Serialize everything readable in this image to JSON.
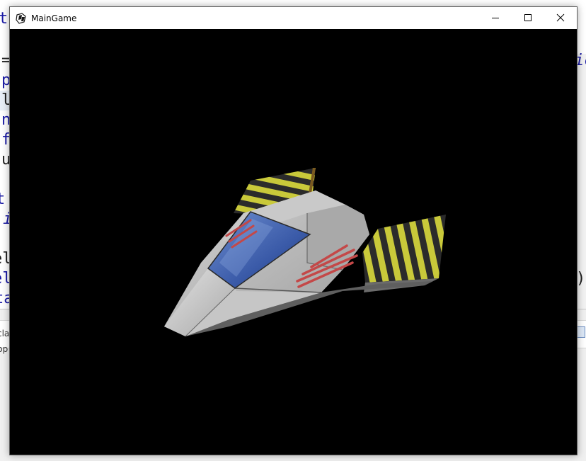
{
  "window": {
    "title": "MainGame",
    "controls": {
      "minimize_icon": "minimize-icon",
      "maximize_icon": "maximize-icon",
      "close_icon": "close-icon"
    }
  },
  "viewport": {
    "background_color": "#000000",
    "object": {
      "icon": "spaceship",
      "hull_color": "#b4b4b4",
      "canopy_color": "#3f62b0",
      "stripe_colors": [
        "#c8c832",
        "#2a2a2a"
      ],
      "vent_color": "#c04040"
    }
  },
  "background_editor": {
    "fragments": [
      "th",
      "=",
      "p",
      "l",
      "n",
      "f",
      "u",
      "t",
      "i",
      "el",
      "el",
      "ta",
      "ic",
      ")"
    ],
    "panel_fragments": [
      "cla",
      "pp"
    ]
  }
}
